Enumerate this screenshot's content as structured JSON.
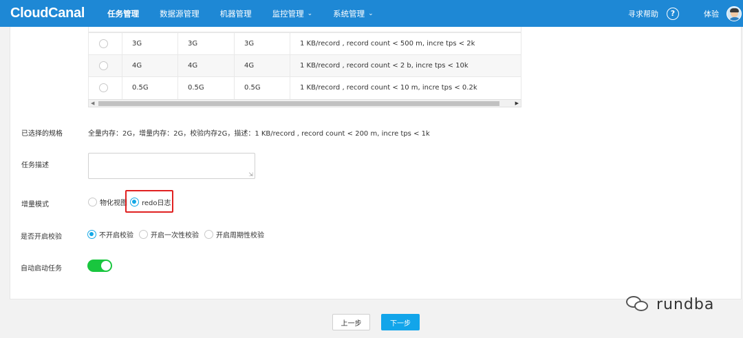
{
  "nav": {
    "logo": "CloudCanal",
    "items": [
      {
        "label": "任务管理"
      },
      {
        "label": "数据源管理"
      },
      {
        "label": "机器管理"
      },
      {
        "label": "监控管理"
      },
      {
        "label": "系统管理"
      }
    ],
    "help": "寻求帮助",
    "help_icon_glyph": "?",
    "user": "体验"
  },
  "spec_table": {
    "rows": [
      {
        "full": "3G",
        "incr": "3G",
        "check": "3G",
        "desc": "1 KB/record , record count < 500 m, incre tps < 2k"
      },
      {
        "full": "4G",
        "incr": "4G",
        "check": "4G",
        "desc": "1 KB/record , record count < 2 b, incre tps < 10k"
      },
      {
        "full": "0.5G",
        "incr": "0.5G",
        "check": "0.5G",
        "desc": "1 KB/record , record count < 10 m, incre tps < 0.2k"
      }
    ]
  },
  "form": {
    "selected_spec_label": "已选择的规格",
    "selected_spec_value": "全量内存：2G，增量内存：2G，校验内存2G，描述：1 KB/record , record count < 200 m, incre tps < 1k",
    "task_desc_label": "任务描述",
    "task_desc_value": "",
    "incr_mode_label": "增量模式",
    "incr_mode_options": [
      {
        "label": "物化视图",
        "checked": false
      },
      {
        "label": "redo日志",
        "checked": true
      }
    ],
    "verify_label": "是否开启校验",
    "verify_options": [
      {
        "label": "不开启校验",
        "checked": true
      },
      {
        "label": "开启一次性校验",
        "checked": false
      },
      {
        "label": "开启周期性校验",
        "checked": false
      }
    ],
    "auto_start_label": "自动启动任务",
    "auto_start_on": true
  },
  "footer": {
    "prev": "上一步",
    "next": "下一步"
  },
  "watermark": "rundba",
  "colors": {
    "header_bg": "#1e88d5",
    "primary": "#12a5ea",
    "toggle_on": "#19c63e",
    "highlight": "#e02020"
  }
}
